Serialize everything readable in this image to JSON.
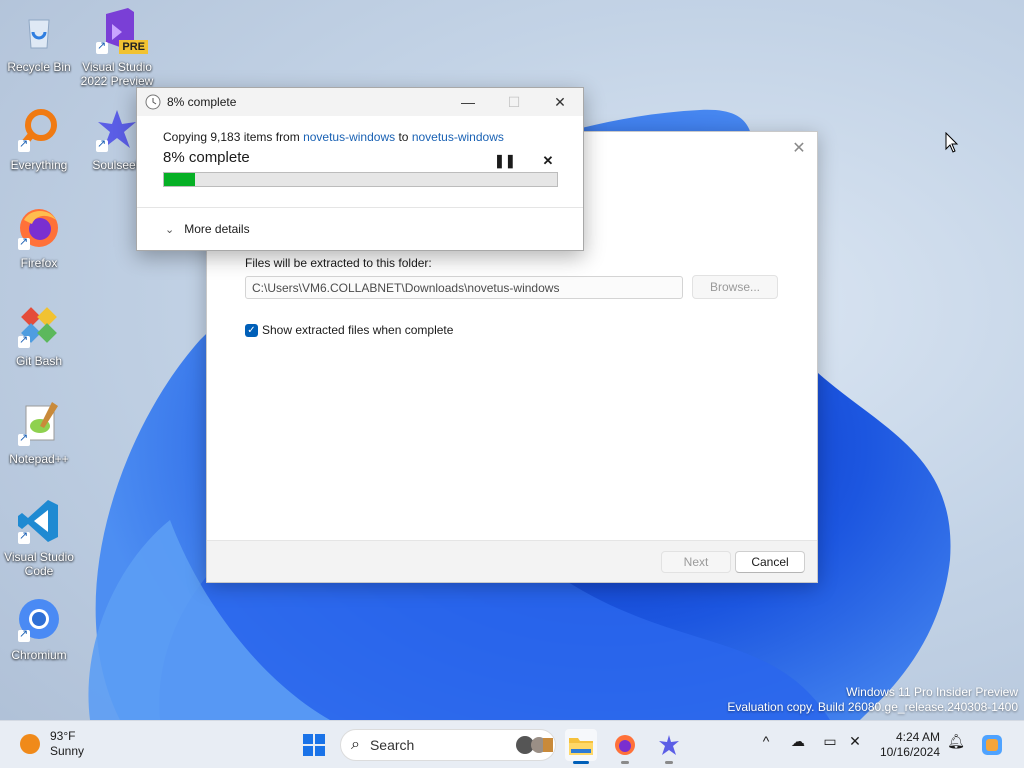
{
  "desktop": {
    "icons": [
      {
        "label": "Recycle Bin",
        "icon": "recycle-bin-icon"
      },
      {
        "label": "Visual Studio 2022 Preview",
        "badge": "PRE",
        "icon": "visual-studio-icon"
      },
      {
        "label": "Everything",
        "icon": "everything-search-icon"
      },
      {
        "label": "Soulseek",
        "icon": "soulseek-icon"
      },
      {
        "label": "Firefox",
        "icon": "firefox-icon"
      },
      {
        "label": "Git Bash",
        "icon": "git-bash-icon"
      },
      {
        "label": "Notepad++",
        "icon": "notepad-plus-plus-icon"
      },
      {
        "label": "Visual Studio Code",
        "icon": "vscode-icon"
      },
      {
        "label": "Chromium",
        "icon": "chromium-icon"
      }
    ],
    "watermark": {
      "line1": "Windows 11 Pro Insider Preview",
      "line2": "Evaluation copy. Build 26080.ge_release.240308-1400"
    }
  },
  "extract_dialog": {
    "folder_label": "Files will be extracted to this folder:",
    "folder_path": "C:\\Users\\VM6.COLLABNET\\Downloads\\novetus-windows",
    "browse_label": "Browse...",
    "show_files_label": "Show extracted files when complete",
    "show_files_checked": true,
    "next_label": "Next",
    "cancel_label": "Cancel",
    "close_glyph": "✕"
  },
  "progress_dialog": {
    "title": "8% complete",
    "copy_prefix": "Copying 9,183 items from",
    "source": "novetus-windows",
    "copy_mid": "to",
    "destination": "novetus-windows",
    "percent_text": "8% complete",
    "percent": 0.08,
    "more_details_label": "More details",
    "pause_glyph": "❚❚",
    "cancel_glyph": "✕",
    "minimize_glyph": "—",
    "maximize_glyph": "☐",
    "close_glyph": "✕"
  },
  "taskbar": {
    "weather_temp": "93°F",
    "weather_cond": "Sunny",
    "search_placeholder": "Search",
    "time": "4:24 AM",
    "date": "10/16/2024",
    "tray_chevron": "^"
  },
  "colors": {
    "accent": "#005fb8",
    "progress_fill": "#06b025",
    "link": "#1a62b4"
  }
}
